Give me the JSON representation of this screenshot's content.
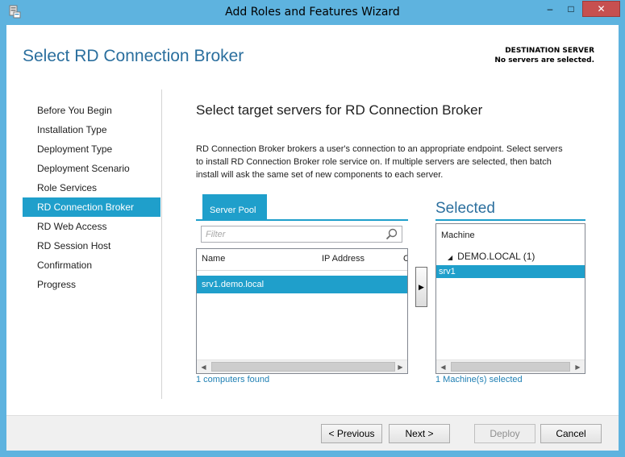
{
  "window": {
    "title": "Add Roles and Features Wizard",
    "minimize_symbol": "–",
    "maximize_symbol": "□",
    "close_symbol": "✕",
    "accent_color": "#5eb3df"
  },
  "header": {
    "page_title": "Select RD Connection Broker",
    "destination_label": "DESTINATION SERVER",
    "destination_value": "No servers are selected."
  },
  "nav": {
    "items": [
      {
        "label": "Before You Begin",
        "active": false
      },
      {
        "label": "Installation Type",
        "active": false
      },
      {
        "label": "Deployment Type",
        "active": false
      },
      {
        "label": "Deployment Scenario",
        "active": false
      },
      {
        "label": "Role Services",
        "active": false
      },
      {
        "label": "RD Connection Broker",
        "active": true
      },
      {
        "label": "RD Web Access",
        "active": false
      },
      {
        "label": "RD Session Host",
        "active": false
      },
      {
        "label": "Confirmation",
        "active": false
      },
      {
        "label": "Progress",
        "active": false
      }
    ]
  },
  "main": {
    "heading": "Select target servers for RD Connection Broker",
    "description": "RD Connection Broker brokers a user's connection to an appropriate endpoint. Select servers to install RD Connection Broker role service on. If multiple servers are selected, then batch install will ask the same set of new components to each server.",
    "tab_label": "Server Pool",
    "filter_placeholder": "Filter",
    "pool_columns": [
      "Name",
      "IP Address",
      "O"
    ],
    "pool_rows": [
      {
        "name": "srv1.demo.local"
      }
    ],
    "pool_count": "1 computers found",
    "add_symbol": "▶"
  },
  "selected": {
    "title": "Selected",
    "column": "Machine",
    "group_label": "DEMO.LOCAL (1)",
    "group_arrow": "◢",
    "items": [
      "srv1"
    ],
    "count": "1 Machine(s) selected"
  },
  "scrollbar": {
    "left_arrow": "◀",
    "right_arrow": "▶"
  },
  "footer": {
    "previous_label": "< Previous",
    "next_label": "Next >",
    "deploy_label": "Deploy",
    "cancel_label": "Cancel"
  },
  "icons": {
    "app": "server-manager-icon",
    "search": "search-icon"
  },
  "colors": {
    "selection": "#1f9fcb",
    "title": "#2b6f9e",
    "link": "#1e7fb3"
  }
}
